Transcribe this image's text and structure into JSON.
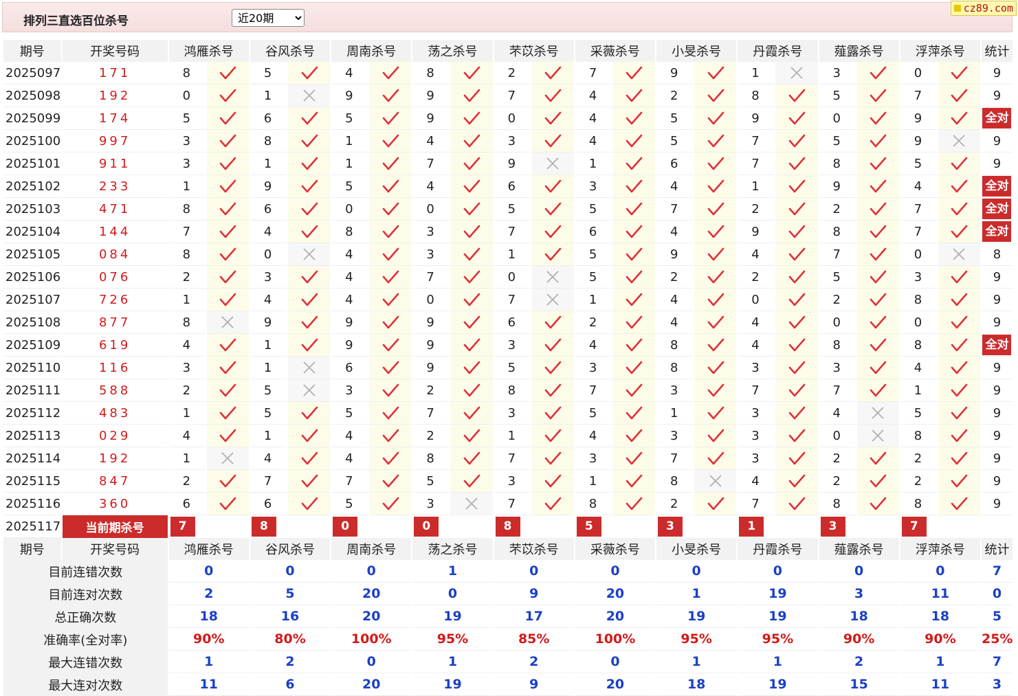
{
  "title": "排列三直选百位杀号",
  "range_select": {
    "selected": "近20期"
  },
  "logo": "cz89.com",
  "headers": {
    "issue": "期号",
    "open": "开奖号码",
    "experts": [
      "鸿雁杀号",
      "谷风杀号",
      "周南杀号",
      "荡之杀号",
      "芣苡杀号",
      "采薇杀号",
      "小旻杀号",
      "丹霞杀号",
      "薤露杀号",
      "浮萍杀号"
    ],
    "stat": "统计"
  },
  "rows": [
    {
      "issue": "2025097",
      "open": "171",
      "kills": [
        8,
        5,
        4,
        8,
        2,
        7,
        9,
        1,
        3,
        0
      ],
      "ok": [
        1,
        1,
        1,
        1,
        1,
        1,
        1,
        0,
        1,
        1
      ],
      "count": "9",
      "all": false
    },
    {
      "issue": "2025098",
      "open": "192",
      "kills": [
        0,
        1,
        9,
        9,
        7,
        4,
        2,
        8,
        5,
        7
      ],
      "ok": [
        1,
        0,
        1,
        1,
        1,
        1,
        1,
        1,
        1,
        1
      ],
      "count": "9",
      "all": false
    },
    {
      "issue": "2025099",
      "open": "174",
      "kills": [
        5,
        6,
        5,
        9,
        0,
        4,
        5,
        9,
        0,
        9
      ],
      "ok": [
        1,
        1,
        1,
        1,
        1,
        1,
        1,
        1,
        1,
        1
      ],
      "count": "全对",
      "all": true
    },
    {
      "issue": "2025100",
      "open": "997",
      "kills": [
        3,
        8,
        1,
        4,
        3,
        4,
        5,
        7,
        5,
        9
      ],
      "ok": [
        1,
        1,
        1,
        1,
        1,
        1,
        1,
        1,
        1,
        0
      ],
      "count": "9",
      "all": false
    },
    {
      "issue": "2025101",
      "open": "911",
      "kills": [
        3,
        1,
        1,
        7,
        9,
        1,
        6,
        7,
        8,
        5
      ],
      "ok": [
        1,
        1,
        1,
        1,
        0,
        1,
        1,
        1,
        1,
        1
      ],
      "count": "9",
      "all": false
    },
    {
      "issue": "2025102",
      "open": "233",
      "kills": [
        1,
        9,
        5,
        4,
        6,
        3,
        4,
        1,
        9,
        4
      ],
      "ok": [
        1,
        1,
        1,
        1,
        1,
        1,
        1,
        1,
        1,
        1
      ],
      "count": "全对",
      "all": true
    },
    {
      "issue": "2025103",
      "open": "471",
      "kills": [
        8,
        6,
        0,
        0,
        5,
        5,
        7,
        2,
        2,
        7
      ],
      "ok": [
        1,
        1,
        1,
        1,
        1,
        1,
        1,
        1,
        1,
        1
      ],
      "count": "全对",
      "all": true
    },
    {
      "issue": "2025104",
      "open": "144",
      "kills": [
        7,
        4,
        8,
        3,
        7,
        6,
        4,
        9,
        8,
        7
      ],
      "ok": [
        1,
        1,
        1,
        1,
        1,
        1,
        1,
        1,
        1,
        1
      ],
      "count": "全对",
      "all": true
    },
    {
      "issue": "2025105",
      "open": "084",
      "kills": [
        8,
        0,
        4,
        3,
        1,
        5,
        9,
        4,
        7,
        0
      ],
      "ok": [
        1,
        0,
        1,
        1,
        1,
        1,
        1,
        1,
        1,
        0
      ],
      "count": "8",
      "all": false
    },
    {
      "issue": "2025106",
      "open": "076",
      "kills": [
        2,
        3,
        4,
        7,
        0,
        5,
        2,
        2,
        5,
        3
      ],
      "ok": [
        1,
        1,
        1,
        1,
        0,
        1,
        1,
        1,
        1,
        1
      ],
      "count": "9",
      "all": false
    },
    {
      "issue": "2025107",
      "open": "726",
      "kills": [
        1,
        4,
        4,
        0,
        7,
        1,
        4,
        0,
        2,
        8
      ],
      "ok": [
        1,
        1,
        1,
        1,
        0,
        1,
        1,
        1,
        1,
        1
      ],
      "count": "9",
      "all": false
    },
    {
      "issue": "2025108",
      "open": "877",
      "kills": [
        8,
        9,
        9,
        9,
        6,
        2,
        4,
        4,
        0,
        0
      ],
      "ok": [
        0,
        1,
        1,
        1,
        1,
        1,
        1,
        1,
        1,
        1
      ],
      "count": "9",
      "all": false
    },
    {
      "issue": "2025109",
      "open": "619",
      "kills": [
        4,
        1,
        9,
        9,
        3,
        4,
        8,
        4,
        8,
        8
      ],
      "ok": [
        1,
        1,
        1,
        1,
        1,
        1,
        1,
        1,
        1,
        1
      ],
      "count": "全对",
      "all": true
    },
    {
      "issue": "2025110",
      "open": "116",
      "kills": [
        3,
        1,
        6,
        9,
        5,
        3,
        8,
        3,
        3,
        4
      ],
      "ok": [
        1,
        0,
        1,
        1,
        1,
        1,
        1,
        1,
        1,
        1
      ],
      "count": "9",
      "all": false
    },
    {
      "issue": "2025111",
      "open": "588",
      "kills": [
        2,
        5,
        3,
        2,
        8,
        7,
        3,
        7,
        7,
        1
      ],
      "ok": [
        1,
        0,
        1,
        1,
        1,
        1,
        1,
        1,
        1,
        1
      ],
      "count": "9",
      "all": false
    },
    {
      "issue": "2025112",
      "open": "483",
      "kills": [
        1,
        5,
        5,
        7,
        3,
        5,
        1,
        3,
        4,
        5
      ],
      "ok": [
        1,
        1,
        1,
        1,
        1,
        1,
        1,
        1,
        0,
        1
      ],
      "count": "9",
      "all": false
    },
    {
      "issue": "2025113",
      "open": "029",
      "kills": [
        4,
        1,
        4,
        2,
        1,
        4,
        3,
        3,
        0,
        8
      ],
      "ok": [
        1,
        1,
        1,
        1,
        1,
        1,
        1,
        1,
        0,
        1
      ],
      "count": "9",
      "all": false
    },
    {
      "issue": "2025114",
      "open": "192",
      "kills": [
        1,
        4,
        4,
        8,
        7,
        3,
        7,
        3,
        2,
        2
      ],
      "ok": [
        0,
        1,
        1,
        1,
        1,
        1,
        1,
        1,
        1,
        1
      ],
      "count": "9",
      "all": false
    },
    {
      "issue": "2025115",
      "open": "847",
      "kills": [
        2,
        7,
        7,
        5,
        3,
        1,
        8,
        4,
        2,
        2
      ],
      "ok": [
        1,
        1,
        1,
        1,
        1,
        1,
        0,
        1,
        1,
        1
      ],
      "count": "9",
      "all": false
    },
    {
      "issue": "2025116",
      "open": "360",
      "kills": [
        6,
        6,
        5,
        3,
        7,
        8,
        2,
        7,
        8,
        8
      ],
      "ok": [
        1,
        1,
        1,
        0,
        1,
        1,
        1,
        1,
        1,
        1
      ],
      "count": "9",
      "all": false
    }
  ],
  "current": {
    "issue": "2025117",
    "label": "当前期杀号",
    "kills": [
      "7",
      "8",
      "0",
      "0",
      "8",
      "5",
      "3",
      "1",
      "3",
      "7"
    ]
  },
  "stats": [
    {
      "label": "目前连错次数",
      "values": [
        "0",
        "0",
        "0",
        "1",
        "0",
        "0",
        "0",
        "0",
        "0",
        "0"
      ],
      "total": "7",
      "red": false
    },
    {
      "label": "目前连对次数",
      "values": [
        "2",
        "5",
        "20",
        "0",
        "9",
        "20",
        "1",
        "19",
        "3",
        "11"
      ],
      "total": "0",
      "red": false
    },
    {
      "label": "总正确次数",
      "values": [
        "18",
        "16",
        "20",
        "19",
        "17",
        "20",
        "19",
        "19",
        "18",
        "18"
      ],
      "total": "5",
      "red": false
    },
    {
      "label": "准确率(全对率)",
      "values": [
        "90%",
        "80%",
        "100%",
        "95%",
        "85%",
        "100%",
        "95%",
        "95%",
        "90%",
        "90%"
      ],
      "total": "25%",
      "red": true
    },
    {
      "label": "最大连错次数",
      "values": [
        "1",
        "2",
        "0",
        "1",
        "2",
        "0",
        "1",
        "1",
        "2",
        "1"
      ],
      "total": "7",
      "red": false
    },
    {
      "label": "最大连对次数",
      "values": [
        "11",
        "6",
        "20",
        "19",
        "9",
        "20",
        "18",
        "19",
        "15",
        "11"
      ],
      "total": "3",
      "red": false
    }
  ],
  "colors": {
    "accent": "#cc2b2b",
    "check": "#e0303a",
    "cross": "#b0b0b0",
    "stat_blue": "#1a3fc7",
    "stat_red": "#d21a1a"
  }
}
